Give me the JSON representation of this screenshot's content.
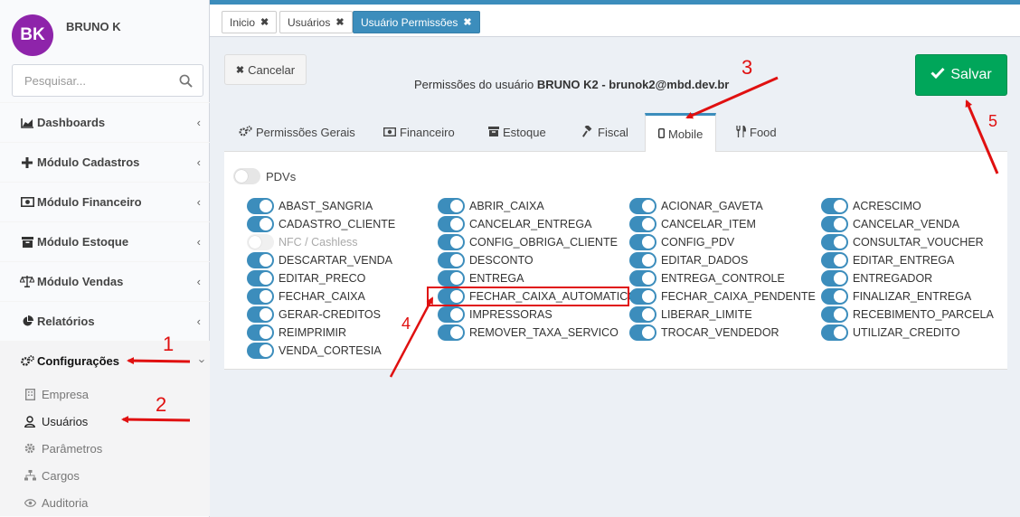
{
  "user": {
    "initials": "BK",
    "name": "BRUNO K"
  },
  "search": {
    "placeholder": "Pesquisar..."
  },
  "sidebar": {
    "items": [
      {
        "label": "Dashboards",
        "icon": "area-chart-icon"
      },
      {
        "label": "Módulo Cadastros",
        "icon": "plus-icon"
      },
      {
        "label": "Módulo Financeiro",
        "icon": "money-icon"
      },
      {
        "label": "Módulo Estoque",
        "icon": "box-icon"
      },
      {
        "label": "Módulo Vendas",
        "icon": "balance-scale-icon"
      },
      {
        "label": "Relatórios",
        "icon": "pie-chart-icon"
      },
      {
        "label": "Configurações",
        "icon": "cogs-icon"
      }
    ],
    "subitems": [
      {
        "label": "Empresa",
        "icon": "building-icon"
      },
      {
        "label": "Usuários",
        "icon": "user-icon"
      },
      {
        "label": "Parâmetros",
        "icon": "gear-icon"
      },
      {
        "label": "Cargos",
        "icon": "sitemap-icon"
      },
      {
        "label": "Auditoria",
        "icon": "eye-icon"
      }
    ]
  },
  "page_tabs": [
    {
      "label": "Inicio"
    },
    {
      "label": "Usuários"
    },
    {
      "label": "Usuário Permissões"
    }
  ],
  "header": {
    "cancel_label": "Cancelar",
    "title_prefix": "Permissões do usuário",
    "title_user": "BRUNO K2 - brunok2@mbd.dev.br",
    "save_label": "Salvar"
  },
  "tabs": [
    {
      "label": "Permissões Gerais",
      "icon": "cogs-icon"
    },
    {
      "label": "Financeiro",
      "icon": "money-icon"
    },
    {
      "label": "Estoque",
      "icon": "box-icon"
    },
    {
      "label": "Fiscal",
      "icon": "gavel-icon"
    },
    {
      "label": "Mobile",
      "icon": "mobile-icon"
    },
    {
      "label": "Food",
      "icon": "cutlery-icon"
    }
  ],
  "pdvs": {
    "label": "PDVs",
    "on": false
  },
  "permissions": {
    "col1": [
      {
        "label": "ABAST_SANGRIA",
        "on": true
      },
      {
        "label": "CADASTRO_CLIENTE",
        "on": true
      },
      {
        "label": "NFC / Cashless",
        "on": false,
        "disabled": true
      },
      {
        "label": "DESCARTAR_VENDA",
        "on": true
      },
      {
        "label": "EDITAR_PRECO",
        "on": true
      },
      {
        "label": "FECHAR_CAIXA",
        "on": true
      },
      {
        "label": "GERAR-CREDITOS",
        "on": true
      },
      {
        "label": "REIMPRIMIR",
        "on": true
      },
      {
        "label": "VENDA_CORTESIA",
        "on": true
      }
    ],
    "col2": [
      {
        "label": "ABRIR_CAIXA",
        "on": true
      },
      {
        "label": "CANCELAR_ENTREGA",
        "on": true
      },
      {
        "label": "CONFIG_OBRIGA_CLIENTE",
        "on": true
      },
      {
        "label": "DESCONTO",
        "on": true
      },
      {
        "label": "ENTREGA",
        "on": true
      },
      {
        "label": "FECHAR_CAIXA_AUTOMATICO",
        "on": true
      },
      {
        "label": "IMPRESSORAS",
        "on": true
      },
      {
        "label": "REMOVER_TAXA_SERVICO",
        "on": true
      }
    ],
    "col3": [
      {
        "label": "ACIONAR_GAVETA",
        "on": true
      },
      {
        "label": "CANCELAR_ITEM",
        "on": true
      },
      {
        "label": "CONFIG_PDV",
        "on": true
      },
      {
        "label": "EDITAR_DADOS",
        "on": true
      },
      {
        "label": "ENTREGA_CONTROLE",
        "on": true
      },
      {
        "label": "FECHAR_CAIXA_PENDENTE",
        "on": true
      },
      {
        "label": "LIBERAR_LIMITE",
        "on": true
      },
      {
        "label": "TROCAR_VENDEDOR",
        "on": true
      }
    ],
    "col4": [
      {
        "label": "ACRESCIMO",
        "on": true
      },
      {
        "label": "CANCELAR_VENDA",
        "on": true
      },
      {
        "label": "CONSULTAR_VOUCHER",
        "on": true
      },
      {
        "label": "EDITAR_ENTREGA",
        "on": true
      },
      {
        "label": "ENTREGADOR",
        "on": true
      },
      {
        "label": "FINALIZAR_ENTREGA",
        "on": true
      },
      {
        "label": "RECEBIMENTO_PARCELA",
        "on": true
      },
      {
        "label": "UTILIZAR_CREDITO",
        "on": true
      }
    ]
  },
  "annotations": {
    "n1": "1",
    "n2": "2",
    "n3": "3",
    "n4": "4",
    "n5": "5",
    "color": "#e01010"
  }
}
